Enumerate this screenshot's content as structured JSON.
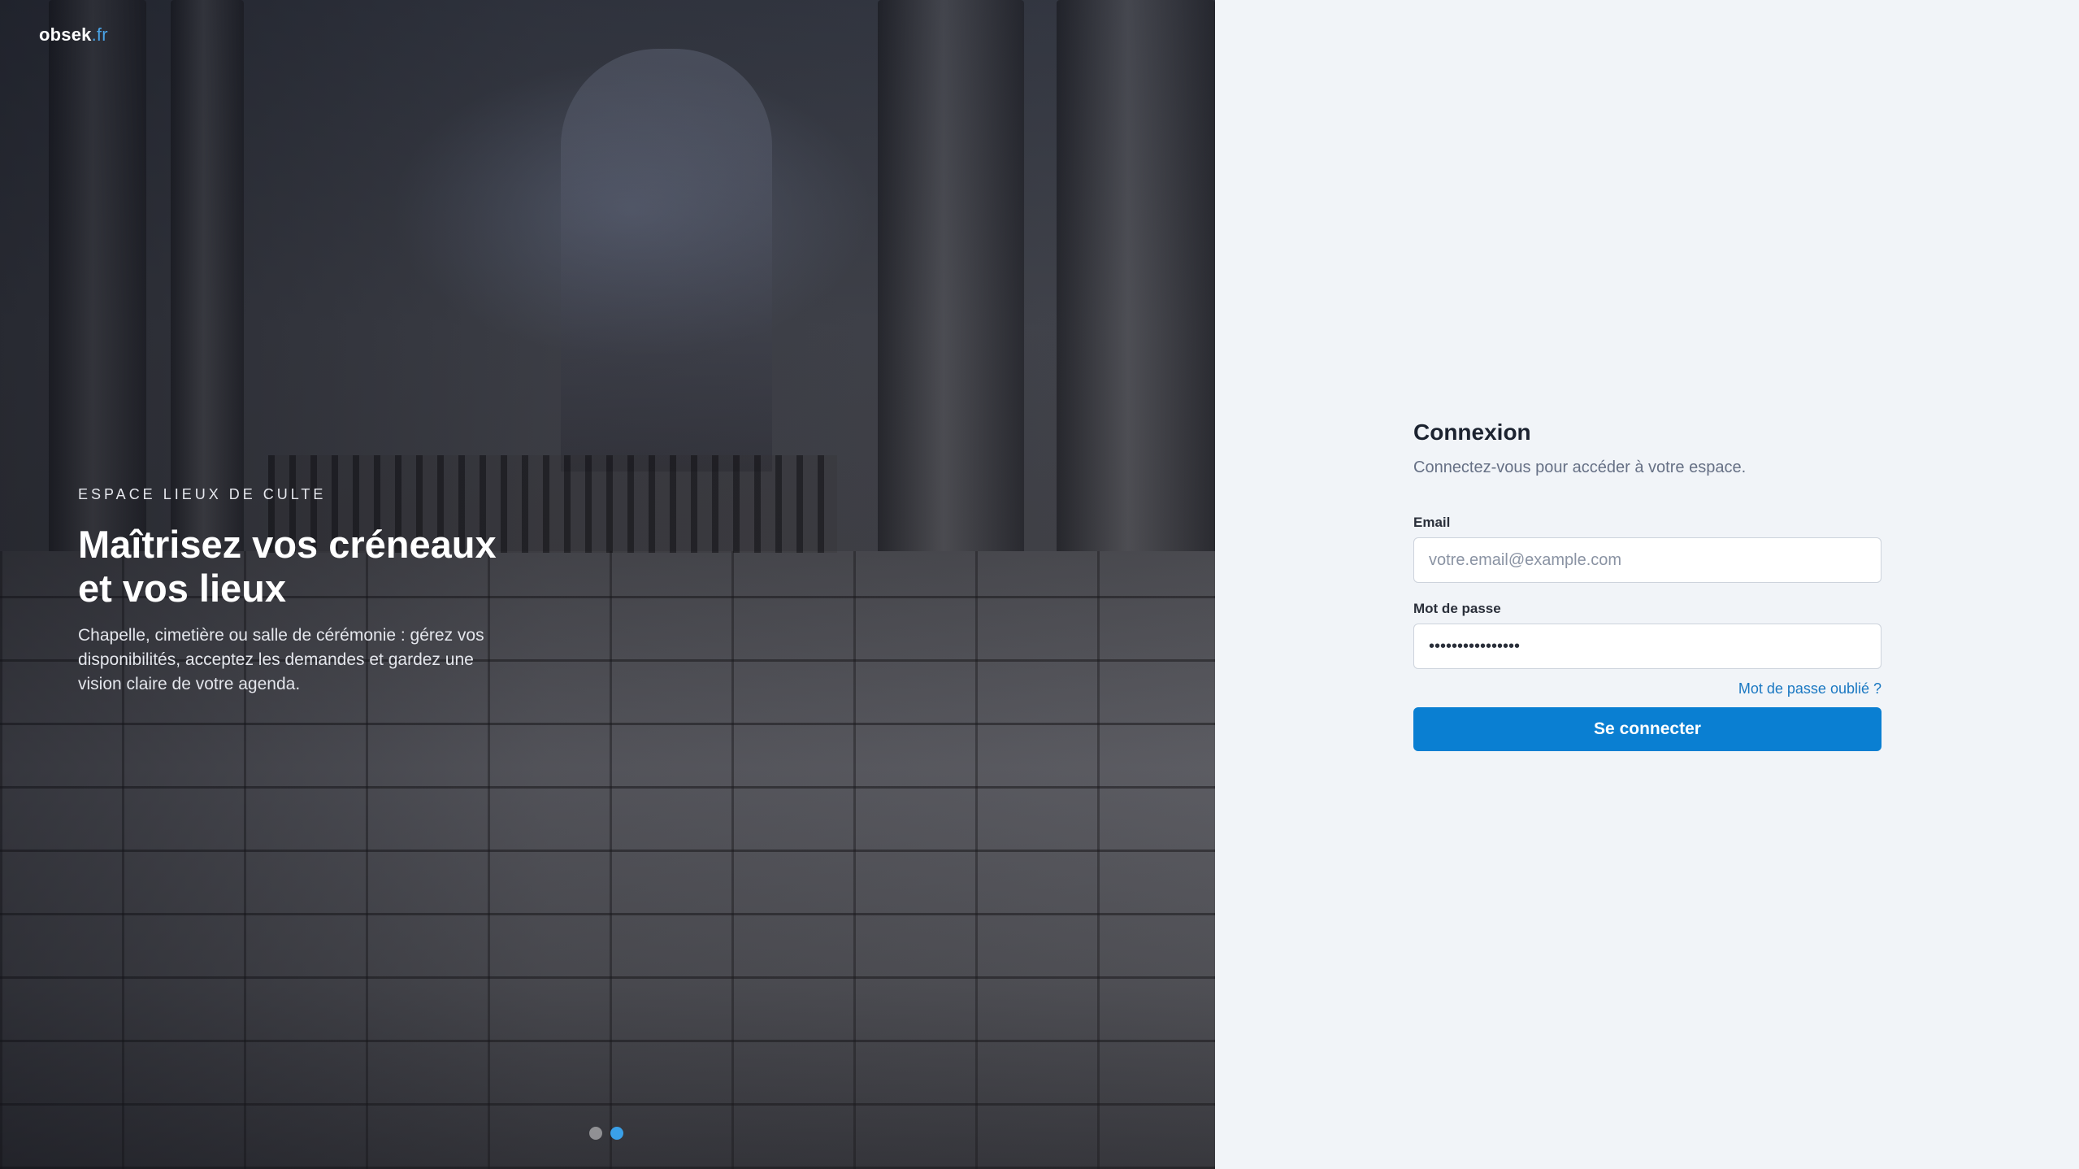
{
  "brand": {
    "name": "obsek",
    "tld": ".fr"
  },
  "hero": {
    "eyebrow": "ESPACE LIEUX DE CULTE",
    "title_line1": "Maîtrisez vos créneaux",
    "title_line2": "et vos lieux",
    "description": "Chapelle, cimetière ou salle de cérémonie : gérez vos disponibilités, acceptez les demandes et gardez une vision claire de votre agenda.",
    "carousel": {
      "total": 2,
      "active": 2
    }
  },
  "login": {
    "title": "Connexion",
    "subtitle": "Connectez-vous pour accéder à votre espace.",
    "email_label": "Email",
    "email_placeholder": "votre.email@example.com",
    "email_value": "",
    "password_label": "Mot de passe",
    "password_value": "••••••••••••••••",
    "forgot_label": "Mot de passe oublié ?",
    "submit_label": "Se connecter"
  },
  "colors": {
    "accent": "#0a7fd2",
    "link": "#1a78c2",
    "panel_bg": "#f1f4f8",
    "dot_active": "#3aa0e8"
  }
}
